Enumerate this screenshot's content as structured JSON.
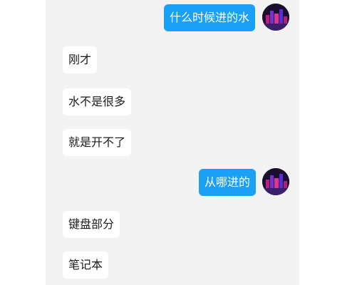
{
  "messages": [
    {
      "side": "out",
      "text": "什么时候进的水"
    },
    {
      "side": "in",
      "text": "刚才"
    },
    {
      "side": "in",
      "text": "水不是很多"
    },
    {
      "side": "in",
      "text": "就是开不了"
    },
    {
      "side": "out",
      "text": "从哪进的"
    },
    {
      "side": "in",
      "text": "键盘部分"
    },
    {
      "side": "in",
      "text": "笔记本"
    }
  ],
  "avatar_icon": "city-night-avatar-icon",
  "colors": {
    "outgoing_bubble": "#1aa0f5",
    "incoming_bubble": "#ffffff",
    "chat_background": "#f3f3f3"
  }
}
